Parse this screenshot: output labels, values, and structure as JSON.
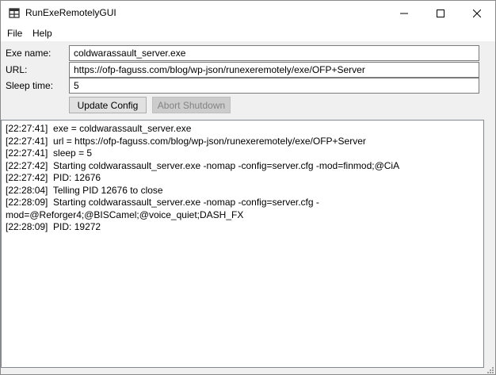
{
  "window": {
    "title": "RunExeRemotelyGUI",
    "icon": "app-icon"
  },
  "menu": {
    "file": "File",
    "help": "Help"
  },
  "form": {
    "exe_label": "Exe name:",
    "exe_value": "coldwarassault_server.exe",
    "url_label": "URL:",
    "url_value": "https://ofp-faguss.com/blog/wp-json/runexeremotely/exe/OFP+Server",
    "sleep_label": "Sleep time:",
    "sleep_value": "5"
  },
  "buttons": {
    "update": "Update Config",
    "abort": "Abort Shutdown"
  },
  "log": [
    "[22:27:41]  exe = coldwarassault_server.exe",
    "[22:27:41]  url = https://ofp-faguss.com/blog/wp-json/runexeremotely/exe/OFP+Server",
    "[22:27:41]  sleep = 5",
    "[22:27:42]  Starting coldwarassault_server.exe -nomap -config=server.cfg -mod=finmod;@CiA",
    "[22:27:42]  PID: 12676",
    "[22:28:04]  Telling PID 12676 to close",
    "[22:28:09]  Starting coldwarassault_server.exe -nomap -config=server.cfg -",
    "mod=@Reforger4;@BISCamel;@voice_quiet;DASH_FX",
    "[22:28:09]  PID: 19272"
  ]
}
